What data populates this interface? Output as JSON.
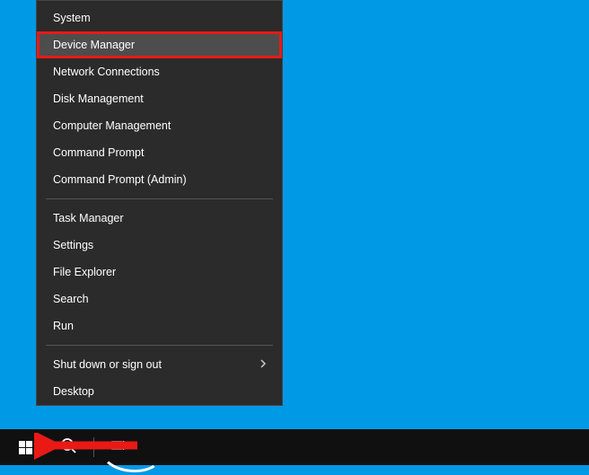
{
  "menu": {
    "group1": [
      "System",
      "Device Manager",
      "Network Connections",
      "Disk Management",
      "Computer Management",
      "Command Prompt",
      "Command Prompt (Admin)"
    ],
    "group2": [
      "Task Manager",
      "Settings",
      "File Explorer",
      "Search",
      "Run"
    ],
    "group3": [
      "Shut down or sign out",
      "Desktop"
    ],
    "highlighted_index": 1,
    "submenu_index_g3": 0
  },
  "taskbar": {
    "start": "Start",
    "search": "Search",
    "taskview": "Task View"
  }
}
